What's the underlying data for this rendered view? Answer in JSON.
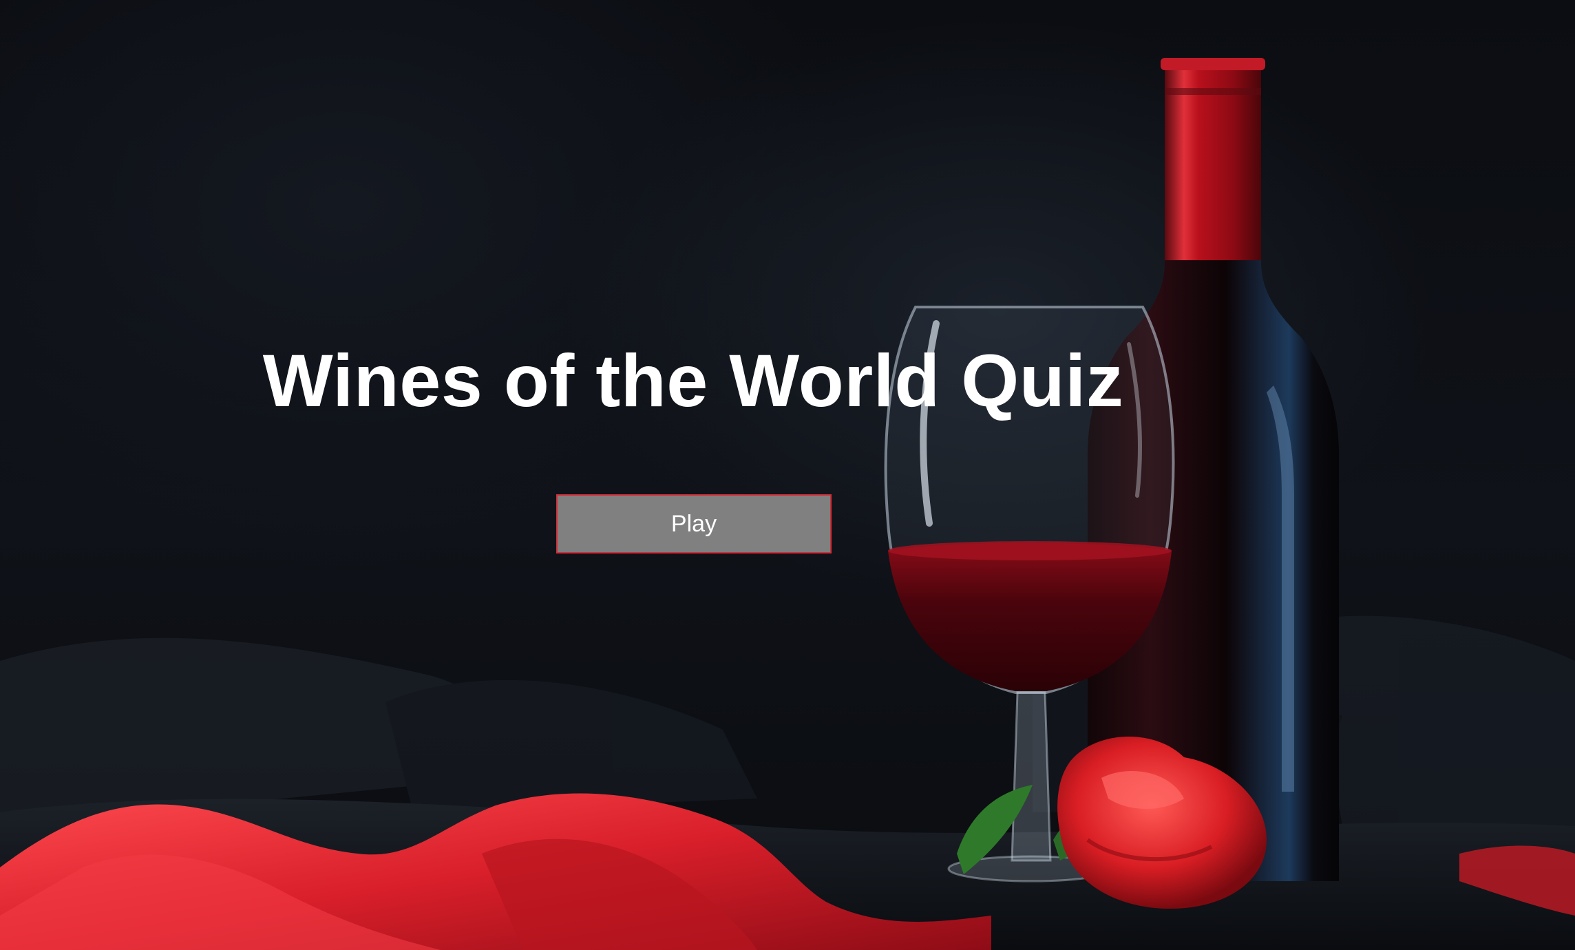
{
  "title": "Wines of the World Quiz",
  "play_button": {
    "label": "Play"
  },
  "background": {
    "subject": "red wine bottle, glass of red wine and red rose on dark satin",
    "accent_color": "#c8102e",
    "button_border_color": "#d0303a",
    "button_fill_color": "#808080"
  }
}
